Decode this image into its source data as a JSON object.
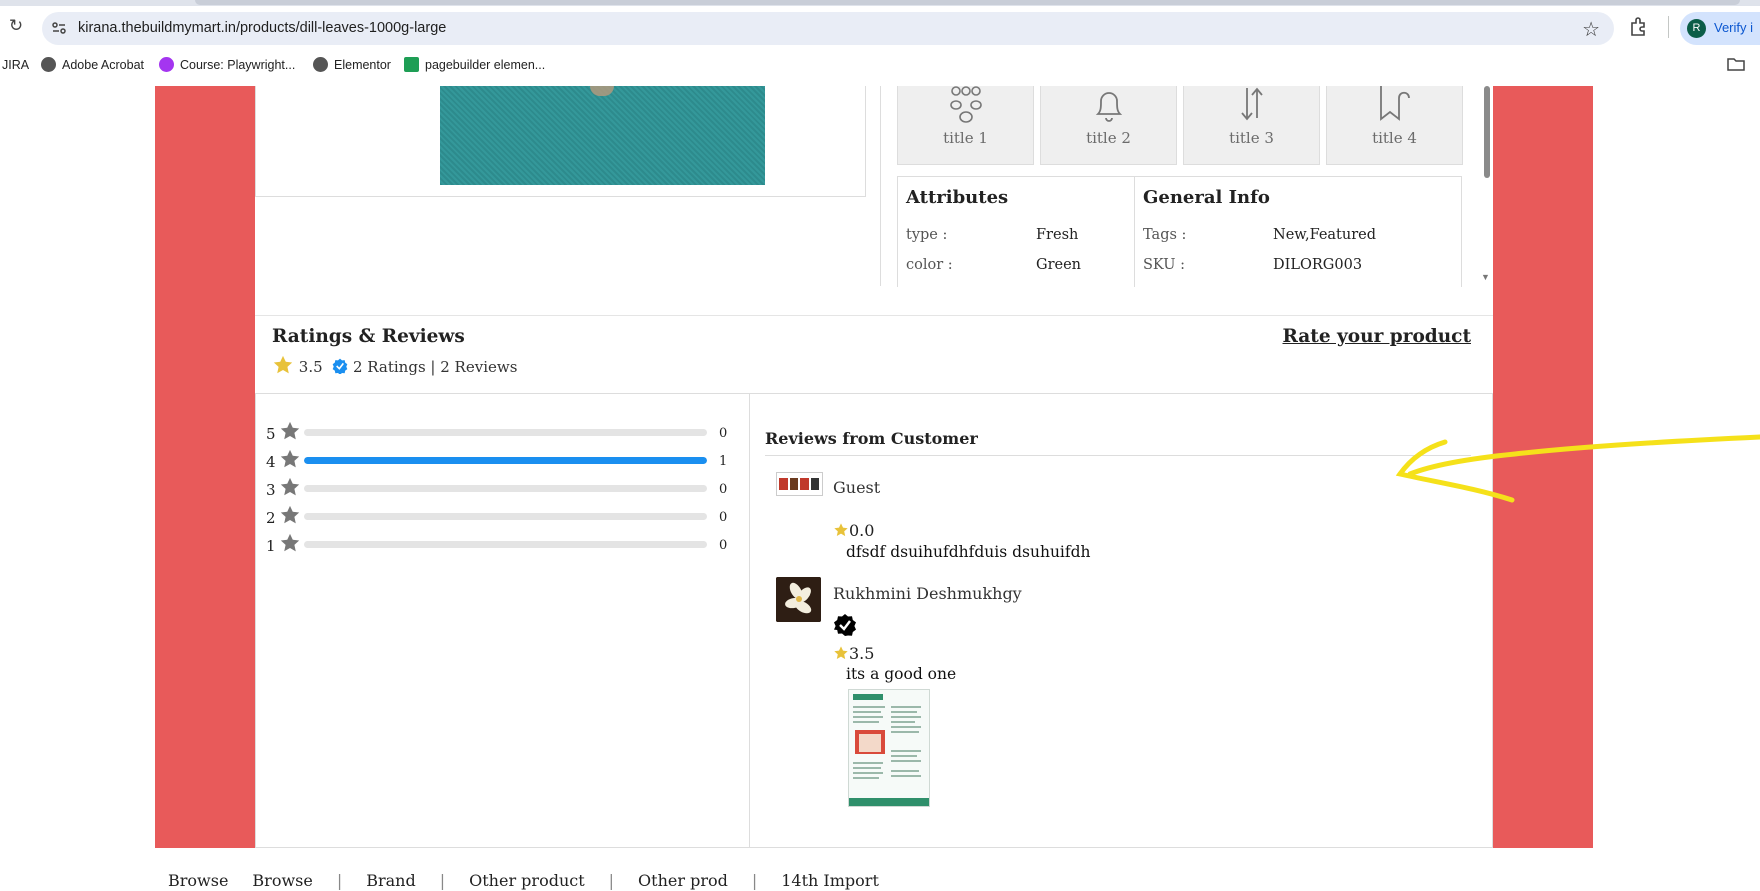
{
  "browser": {
    "url": "kirana.thebuildmymart.in/products/dill-leaves-1000g-large",
    "profile_initial": "R",
    "profile_button_label": "Verify i",
    "bookmarks": [
      "JIRA",
      "Adobe Acrobat",
      "Course: Playwright...",
      "Elementor",
      "pagebuilder elemen..."
    ]
  },
  "product": {
    "feature_cards": [
      {
        "title": "title 1",
        "icon": "group-icon"
      },
      {
        "title": "title 2",
        "icon": "bell-icon"
      },
      {
        "title": "title 3",
        "icon": "sort-arrows-icon"
      },
      {
        "title": "title 4",
        "icon": "bookmark-icon"
      }
    ],
    "attributes": {
      "heading": "Attributes",
      "rows": [
        {
          "label": "type :",
          "value": "Fresh"
        },
        {
          "label": "color :",
          "value": "Green"
        }
      ]
    },
    "general_info": {
      "heading": "General Info",
      "rows": [
        {
          "label": "Tags :",
          "value": "New,Featured"
        },
        {
          "label": "SKU :",
          "value": "DILORG003"
        }
      ]
    }
  },
  "ratings": {
    "heading": "Ratings & Reviews",
    "average": "3.5",
    "summary": "2 Ratings | 2 Reviews",
    "rate_link": "Rate your product",
    "distribution": [
      {
        "stars": "5",
        "count": "0",
        "fraction": 0
      },
      {
        "stars": "4",
        "count": "1",
        "fraction": 1
      },
      {
        "stars": "3",
        "count": "0",
        "fraction": 0
      },
      {
        "stars": "2",
        "count": "0",
        "fraction": 0
      },
      {
        "stars": "1",
        "count": "0",
        "fraction": 0
      }
    ]
  },
  "reviews": {
    "heading": "Reviews from Customer",
    "items": [
      {
        "name": "Guest",
        "rating": "0.0",
        "text": "dfsdf dsuihufdhfduis dsuhuifdh",
        "verified": false,
        "has_image": false
      },
      {
        "name": "Rukhmini Deshmukhgy",
        "rating": "3.5",
        "text": "its a good one",
        "verified": true,
        "has_image": true
      }
    ]
  },
  "colors": {
    "side_bg": "#e85a5a",
    "progress_fill": "#1a8ff0",
    "star_gold": "#e8c23a",
    "star_gray": "#777777",
    "annotation": "#f5e11a"
  },
  "footer_nav": [
    "Browse",
    "Browse",
    "Brand",
    "Other product",
    "Other prod",
    "14th Import"
  ]
}
